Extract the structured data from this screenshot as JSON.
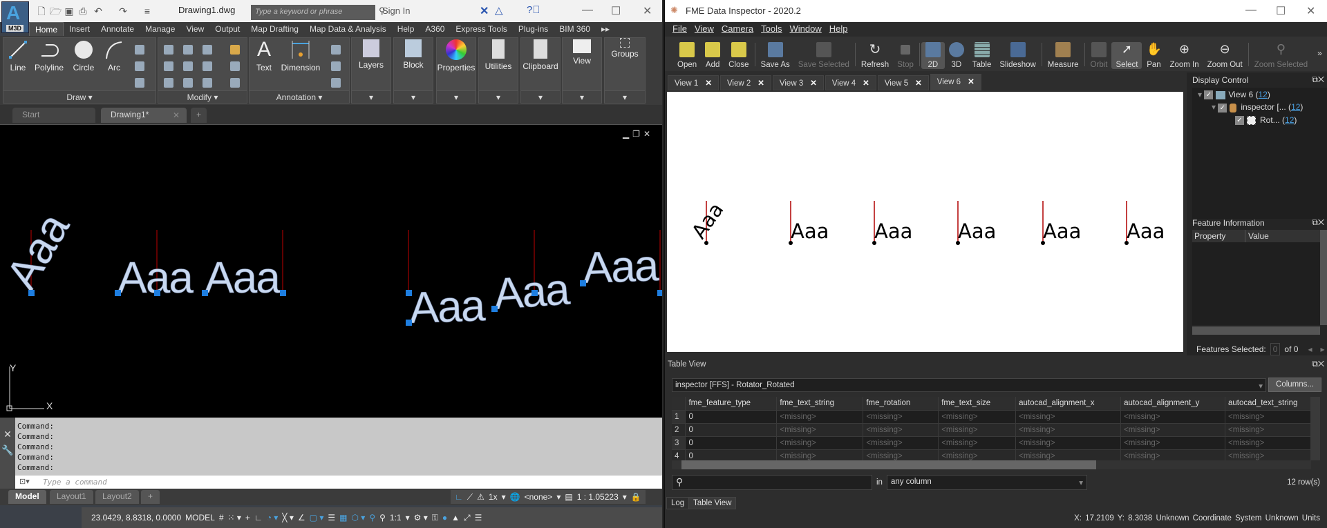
{
  "autocad": {
    "logo": {
      "letter": "A",
      "product": "M3D"
    },
    "document_title": "Drawing1.dwg",
    "search_placeholder": "Type a keyword or phrase",
    "sign_in": "Sign In",
    "ribbon_tabs": [
      "Home",
      "Insert",
      "Annotate",
      "Manage",
      "View",
      "Output",
      "Map Drafting",
      "Map Data & Analysis",
      "Help",
      "A360",
      "Express Tools",
      "Plug-ins",
      "BIM 360"
    ],
    "active_ribbon_tab": "Home",
    "panels": {
      "draw": {
        "title": "Draw",
        "tools": [
          "Line",
          "Polyline",
          "Circle",
          "Arc"
        ]
      },
      "modify": {
        "title": "Modify"
      },
      "annotation": {
        "title": "Annotation",
        "tools": [
          "Text",
          "Dimension"
        ]
      },
      "single": [
        "Layers",
        "Block",
        "Properties",
        "Utilities",
        "Clipboard",
        "View",
        "Groups"
      ]
    },
    "file_tabs": [
      "Start",
      "Drawing1*"
    ],
    "drawing_texts": [
      "Aaa",
      "Aaa",
      "Aaa",
      "Aaa",
      "Aaa",
      "Aaa"
    ],
    "ucs": {
      "x": "X",
      "y": "Y"
    },
    "command_history": [
      "Command:",
      "Command:",
      "Command:",
      "Command:",
      "Command:"
    ],
    "command_placeholder": "Type a command",
    "layout_tabs": [
      "Model",
      "Layout1",
      "Layout2"
    ],
    "status": {
      "coordinates": "23.0429, 8.8318, 0.0000",
      "space": "MODEL",
      "annotation_scale_factor": "1x",
      "coordinate_system": "<none>",
      "viewport_scale": "1 : 1.05223",
      "anno_scale": "1:1"
    },
    "colors": {
      "text": "#c8d8f0",
      "grip": "#1e7ee0",
      "axis_line": "#c00000"
    }
  },
  "fme": {
    "title": "FME Data Inspector - 2020.2",
    "menu": [
      "File",
      "View",
      "Camera",
      "Tools",
      "Window",
      "Help"
    ],
    "toolbar": [
      {
        "label": "Open",
        "state": "normal"
      },
      {
        "label": "Add",
        "state": "normal"
      },
      {
        "label": "Close",
        "state": "normal"
      },
      {
        "label": "Save As",
        "state": "normal"
      },
      {
        "label": "Save Selected",
        "state": "disabled"
      },
      {
        "label": "Refresh",
        "state": "normal"
      },
      {
        "label": "Stop",
        "state": "disabled"
      },
      {
        "label": "2D",
        "state": "active"
      },
      {
        "label": "3D",
        "state": "normal"
      },
      {
        "label": "Table",
        "state": "normal"
      },
      {
        "label": "Slideshow",
        "state": "normal"
      },
      {
        "label": "Measure",
        "state": "normal"
      },
      {
        "label": "Orbit",
        "state": "disabled"
      },
      {
        "label": "Select",
        "state": "active"
      },
      {
        "label": "Pan",
        "state": "normal"
      },
      {
        "label": "Zoom In",
        "state": "normal"
      },
      {
        "label": "Zoom Out",
        "state": "normal"
      },
      {
        "label": "Zoom Selected",
        "state": "disabled"
      }
    ],
    "view_tabs": [
      "View 1",
      "View 2",
      "View 3",
      "View 4",
      "View 5",
      "View 6"
    ],
    "active_view_tab": "View 6",
    "canvas_texts": [
      "Aaa",
      "Aaa",
      "Aaa",
      "Aaa",
      "Aaa",
      "Aaa"
    ],
    "display_control": {
      "title": "Display Control",
      "tree": [
        {
          "label": "View 6 (",
          "count": "12"
        },
        {
          "label": "inspector [... (",
          "count": "12"
        },
        {
          "label": "Rot... (",
          "count": "12"
        }
      ]
    },
    "feature_information": {
      "title": "Feature Information",
      "columns": [
        "Property",
        "Value"
      ],
      "features_selected_label": "Features Selected:",
      "features_selected_value": "0",
      "of_total": "of 0"
    },
    "table_view": {
      "title": "Table View",
      "dataset": "inspector [FFS] - Rotator_Rotated",
      "columns_button": "Columns...",
      "headers": [
        "fme_feature_type",
        "fme_text_string",
        "fme_rotation",
        "fme_text_size",
        "autocad_alignment_x",
        "autocad_alignment_y",
        "autocad_text_string"
      ],
      "rows": [
        [
          "1",
          "0",
          "<missing>",
          "<missing>",
          "<missing>",
          "<missing>",
          "<missing>",
          "<missing>"
        ],
        [
          "2",
          "0",
          "<missing>",
          "<missing>",
          "<missing>",
          "<missing>",
          "<missing>",
          "<missing>"
        ],
        [
          "3",
          "0",
          "<missing>",
          "<missing>",
          "<missing>",
          "<missing>",
          "<missing>",
          "<missing>"
        ],
        [
          "4",
          "0",
          "<missing>",
          "<missing>",
          "<missing>",
          "<missing>",
          "<missing>",
          "<missing>"
        ]
      ],
      "search_value": "",
      "in_label": "in",
      "column_filter": "any column",
      "row_count": "12 row(s)"
    },
    "bottom_tabs": [
      "Log",
      "Table View"
    ],
    "status": "X:  17.2109  Y:  8.3038  Unknown Coordinate System  Unknown Units"
  }
}
